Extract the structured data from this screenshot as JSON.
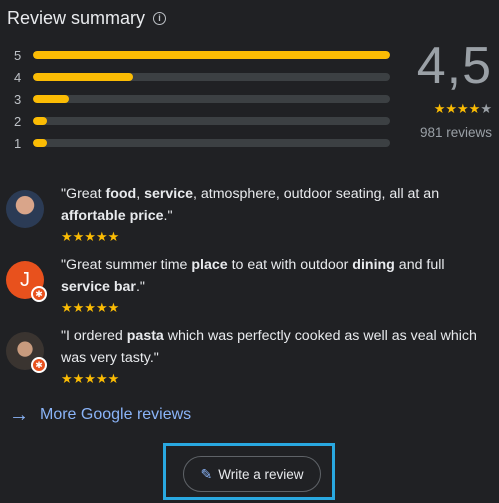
{
  "summary": {
    "title": "Review summary",
    "info_icon": "info-icon",
    "score": "4,5",
    "score_stars": "★★★★",
    "score_star_half": "★",
    "review_count": "981 reviews",
    "distribution": [
      {
        "label": "5",
        "fraction": 1.0
      },
      {
        "label": "4",
        "fraction": 0.28
      },
      {
        "label": "3",
        "fraction": 0.1
      },
      {
        "label": "2",
        "fraction": 0.04
      },
      {
        "label": "1",
        "fraction": 0.04
      }
    ]
  },
  "reviews": [
    {
      "avatar_letter": "",
      "stars": "★★★★★"
    },
    {
      "avatar_letter": "J",
      "stars": "★★★★★"
    },
    {
      "avatar_letter": "",
      "stars": "★★★★★"
    }
  ],
  "more": {
    "label": "More Google reviews",
    "icon": "arrow-right-icon"
  },
  "write": {
    "label": "Write a review",
    "icon": "pencil-icon"
  },
  "colors": {
    "accent": "#8ab4f8",
    "star": "#fbbc04",
    "highlight": "#29a8e0"
  }
}
